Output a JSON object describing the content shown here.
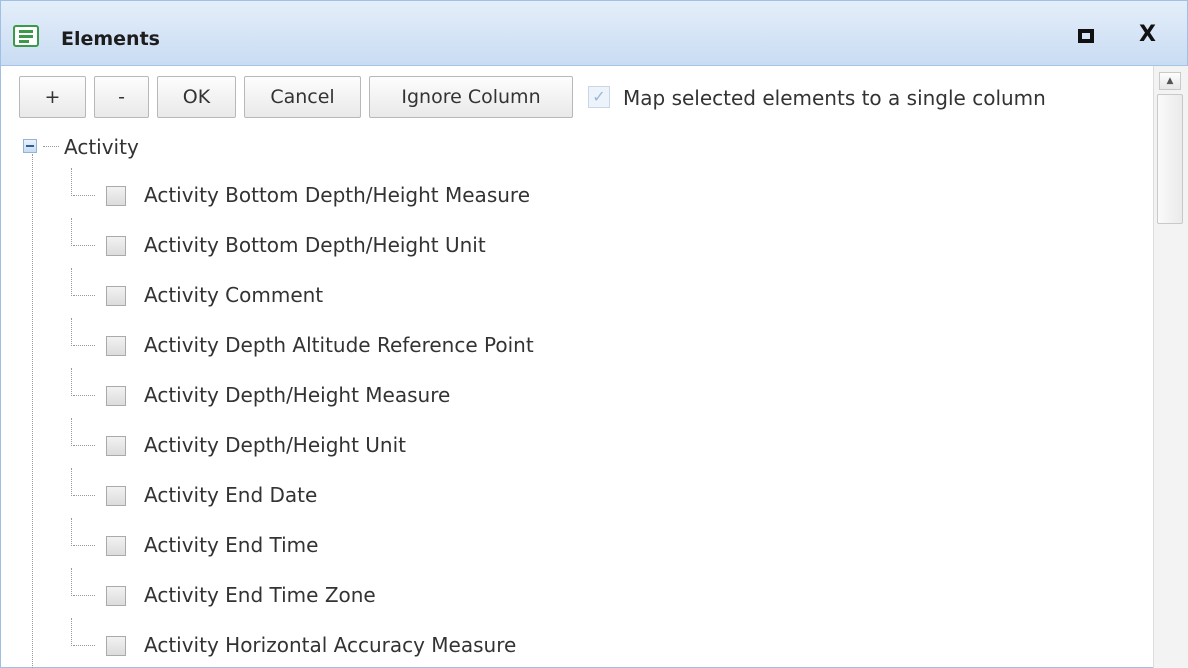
{
  "window": {
    "title": "Elements"
  },
  "toolbar": {
    "add_label": "+",
    "remove_label": "-",
    "ok_label": "OK",
    "cancel_label": "Cancel",
    "ignore_label": "Ignore Column",
    "map_single_label": "Map selected elements to a single column",
    "map_single_checked": true
  },
  "tree": {
    "root_label": "Activity",
    "root_expanded": true,
    "items": [
      {
        "label": "Activity Bottom Depth/Height Measure",
        "checked": false
      },
      {
        "label": "Activity Bottom Depth/Height Unit",
        "checked": false
      },
      {
        "label": "Activity Comment",
        "checked": false
      },
      {
        "label": "Activity Depth Altitude Reference Point",
        "checked": false
      },
      {
        "label": "Activity Depth/Height Measure",
        "checked": false
      },
      {
        "label": "Activity Depth/Height Unit",
        "checked": false
      },
      {
        "label": "Activity End Date",
        "checked": false
      },
      {
        "label": "Activity End Time",
        "checked": false
      },
      {
        "label": "Activity End Time Zone",
        "checked": false
      },
      {
        "label": "Activity Horizontal Accuracy Measure",
        "checked": false
      }
    ]
  },
  "icons": {
    "app": "list-window-icon",
    "maximize": "maximize-icon",
    "close": "close-icon",
    "collapse": "collapse-icon",
    "scroll_up": "arrow-up-icon"
  },
  "colors": {
    "titlebar": "#c9dcf3",
    "app_icon": "#3a9a4a",
    "border": "#9fbfe3"
  }
}
